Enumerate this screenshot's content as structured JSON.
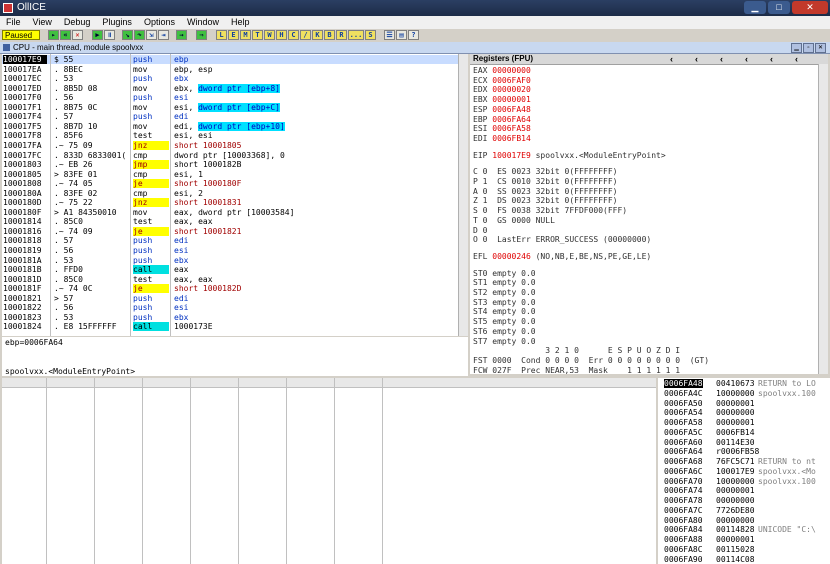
{
  "window": {
    "title": "OllICE"
  },
  "menu": [
    "File",
    "View",
    "Debug",
    "Plugins",
    "Options",
    "Window",
    "Help"
  ],
  "toolbar": {
    "status": "Paused",
    "buttons": [
      "L",
      "E",
      "M",
      "T",
      "W",
      "H",
      "C",
      "/",
      "K",
      "B",
      "R",
      "...",
      "S"
    ]
  },
  "cpu_title": "CPU - main thread, module spoolvxx",
  "disasm": [
    {
      "addr": "100017E9",
      "bytes": "$ 55",
      "mnem": "push",
      "ops": "ebp",
      "kind": "push",
      "sel": true
    },
    {
      "addr": "100017EA",
      "bytes": ". 8BEC",
      "mnem": "mov",
      "ops": "ebp, esp",
      "kind": "mov"
    },
    {
      "addr": "100017EC",
      "bytes": ". 53",
      "mnem": "push",
      "ops": "ebx",
      "kind": "push"
    },
    {
      "addr": "100017ED",
      "bytes": ". 8B5D 08",
      "mnem": "mov",
      "ops": "ebx, ",
      "dw": "dword ptr [ebp+8]",
      "kind": "mov"
    },
    {
      "addr": "100017F0",
      "bytes": ". 56",
      "mnem": "push",
      "ops": "esi",
      "kind": "push"
    },
    {
      "addr": "100017F1",
      "bytes": ". 8B75 0C",
      "mnem": "mov",
      "ops": "esi, ",
      "dw": "dword ptr [ebp+C]",
      "kind": "mov"
    },
    {
      "addr": "100017F4",
      "bytes": ". 57",
      "mnem": "push",
      "ops": "edi",
      "kind": "push"
    },
    {
      "addr": "100017F5",
      "bytes": ". 8B7D 10",
      "mnem": "mov",
      "ops": "edi, ",
      "dw": "dword ptr [ebp+10]",
      "kind": "mov"
    },
    {
      "addr": "100017F8",
      "bytes": ". 85F6",
      "mnem": "test",
      "ops": "esi, esi",
      "kind": "mov"
    },
    {
      "addr": "100017FA",
      "bytes": ".~ 75 09",
      "mnem": "jnz",
      "ops": "short 10001805",
      "kind": "jcc"
    },
    {
      "addr": "100017FC",
      "bytes": ". 833D 6833001(",
      "mnem": "cmp",
      "ops": "dword ptr [10003368], 0",
      "kind": "cmp"
    },
    {
      "addr": "10001803",
      "bytes": ".~ EB 26",
      "mnem": "jmp",
      "ops": "short 1000182B",
      "kind": "jmp"
    },
    {
      "addr": "10001805",
      "bytes": "> 83FE 01",
      "mnem": "cmp",
      "ops": "esi, 1",
      "kind": "cmp"
    },
    {
      "addr": "10001808",
      "bytes": ".~ 74 05",
      "mnem": "je",
      "ops": "short 1000180F",
      "kind": "jcc"
    },
    {
      "addr": "1000180A",
      "bytes": ". 83FE 02",
      "mnem": "cmp",
      "ops": "esi, 2",
      "kind": "cmp"
    },
    {
      "addr": "1000180D",
      "bytes": ".~ 75 22",
      "mnem": "jnz",
      "ops": "short 10001831",
      "kind": "jcc"
    },
    {
      "addr": "1000180F",
      "bytes": "> A1 84350010",
      "mnem": "mov",
      "ops": "eax, dword ptr [10003584]",
      "kind": "mov"
    },
    {
      "addr": "10001814",
      "bytes": ". 85C0",
      "mnem": "test",
      "ops": "eax, eax",
      "kind": "mov"
    },
    {
      "addr": "10001816",
      "bytes": ".~ 74 09",
      "mnem": "je",
      "ops": "short 10001821",
      "kind": "jcc"
    },
    {
      "addr": "10001818",
      "bytes": ". 57",
      "mnem": "push",
      "ops": "edi",
      "kind": "push"
    },
    {
      "addr": "10001819",
      "bytes": ". 56",
      "mnem": "push",
      "ops": "esi",
      "kind": "push"
    },
    {
      "addr": "1000181A",
      "bytes": ". 53",
      "mnem": "push",
      "ops": "ebx",
      "kind": "push"
    },
    {
      "addr": "1000181B",
      "bytes": ". FFD0",
      "mnem": "call",
      "ops": "eax",
      "kind": "call"
    },
    {
      "addr": "1000181D",
      "bytes": ". 85C0",
      "mnem": "test",
      "ops": "eax, eax",
      "kind": "mov"
    },
    {
      "addr": "1000181F",
      "bytes": ".~ 74 0C",
      "mnem": "je",
      "ops": "short 1000182D",
      "kind": "jcc"
    },
    {
      "addr": "10001821",
      "bytes": "> 57",
      "mnem": "push",
      "ops": "edi",
      "kind": "push"
    },
    {
      "addr": "10001822",
      "bytes": ". 56",
      "mnem": "push",
      "ops": "esi",
      "kind": "push"
    },
    {
      "addr": "10001823",
      "bytes": ". 53",
      "mnem": "push",
      "ops": "ebx",
      "kind": "push"
    },
    {
      "addr": "10001824",
      "bytes": ". E8 15FFFFFF",
      "mnem": "call",
      "ops": "1000173E",
      "kind": "call"
    }
  ],
  "info": {
    "line1": "ebp=0006FA64",
    "line2": "spoolvxx.<ModuleEntryPoint>"
  },
  "registers": {
    "title": "Registers (FPU)",
    "gpr": [
      {
        "n": "EAX",
        "v": "00000000"
      },
      {
        "n": "ECX",
        "v": "0006FAF0"
      },
      {
        "n": "EDX",
        "v": "00000020"
      },
      {
        "n": "EBX",
        "v": "00000001"
      },
      {
        "n": "ESP",
        "v": "0006FA48"
      },
      {
        "n": "EBP",
        "v": "0006FA64"
      },
      {
        "n": "ESI",
        "v": "0006FA58"
      },
      {
        "n": "EDI",
        "v": "0006FB14"
      }
    ],
    "eip": {
      "n": "EIP",
      "v": "100017E9",
      "c": "spoolvxx.<ModuleEntryPoint>"
    },
    "flags": [
      "C 0  ES 0023 32bit 0(FFFFFFFF)",
      "P 1  CS 0010 32bit 0(FFFFFFFF)",
      "A 0  SS 0023 32bit 0(FFFFFFFF)",
      "Z 1  DS 0023 32bit 0(FFFFFFFF)",
      "S 0  FS 0038 32bit 7FFDF000(FFF)",
      "T 0  GS 0000 NULL",
      "D 0",
      "O 0  LastErr ERROR_SUCCESS (00000000)"
    ],
    "efl": {
      "n": "EFL",
      "v": "00000246",
      "c": "(NO,NB,E,BE,NS,PE,GE,LE)"
    },
    "fpu": [
      "ST0 empty 0.0",
      "ST1 empty 0.0",
      "ST2 empty 0.0",
      "ST3 empty 0.0",
      "ST4 empty 0.0",
      "ST5 empty 0.0",
      "ST6 empty 0.0",
      "ST7 empty 0.0"
    ],
    "fpu_bits_header": "               3 2 1 0      E S P U O Z D I",
    "fst": "FST 0000  Cond 0 0 0 0  Err 0 0 0 0 0 0 0 0  (GT)",
    "fcw": "FCW 027F  Prec NEAR,53  Mask    1 1 1 1 1 1"
  },
  "stack": [
    {
      "a": "0006FA48",
      "v": "00410673",
      "c": "RETURN to LO",
      "sel": true
    },
    {
      "a": "0006FA4C",
      "v": "10000000",
      "c": "spoolvxx.100"
    },
    {
      "a": "0006FA50",
      "v": "00000001",
      "c": ""
    },
    {
      "a": "0006FA54",
      "v": "00000000",
      "c": ""
    },
    {
      "a": "0006FA58",
      "v": "00000001",
      "c": ""
    },
    {
      "a": "0006FA5C",
      "v": "0006FB14",
      "c": ""
    },
    {
      "a": "0006FA60",
      "v": "00114E30",
      "c": ""
    },
    {
      "a": "0006FA64",
      "v": "r0006FB58",
      "c": ""
    },
    {
      "a": "0006FA68",
      "v": "76FC5C71",
      "c": "RETURN to nt"
    },
    {
      "a": "0006FA6C",
      "v": "100017E9",
      "c": "spoolvxx.<Mo"
    },
    {
      "a": "0006FA70",
      "v": "10000000",
      "c": "spoolvxx.100"
    },
    {
      "a": "0006FA74",
      "v": "00000001",
      "c": ""
    },
    {
      "a": "0006FA78",
      "v": "00000000",
      "c": ""
    },
    {
      "a": "0006FA7C",
      "v": "7726DE80",
      "c": ""
    },
    {
      "a": "0006FA80",
      "v": "00000000",
      "c": ""
    },
    {
      "a": "0006FA84",
      "v": "00114828",
      "c": "UNICODE \"C:\\"
    },
    {
      "a": "0006FA88",
      "v": "00000001",
      "c": ""
    },
    {
      "a": "0006FA8C",
      "v": "00115028",
      "c": ""
    },
    {
      "a": "0006FA90",
      "v": "00114C08",
      "c": ""
    }
  ]
}
